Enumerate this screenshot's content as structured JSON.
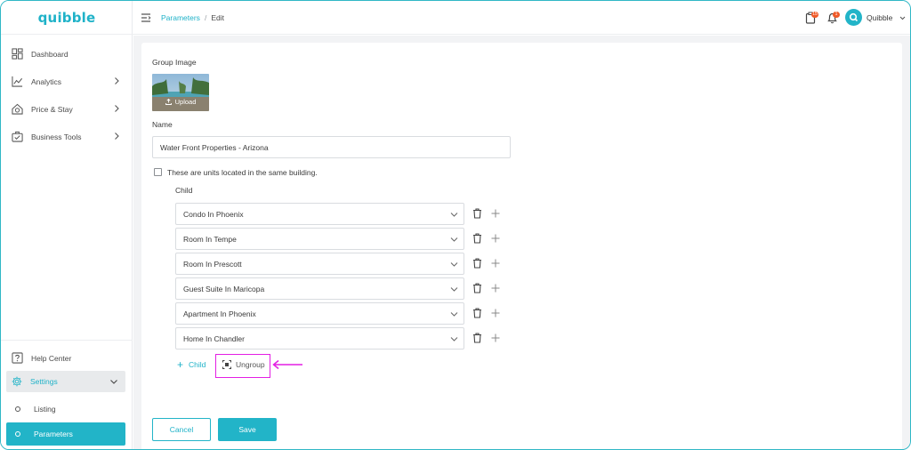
{
  "app": {
    "logo": "quibble",
    "brand_color": "#22b4c8",
    "highlight_color": "#e31fe3"
  },
  "sidebar": {
    "items": [
      {
        "label": "Dashboard",
        "icon": "dashboard-icon"
      },
      {
        "label": "Analytics",
        "icon": "analytics-icon"
      },
      {
        "label": "Price & Stay",
        "icon": "price-stay-icon"
      },
      {
        "label": "Business Tools",
        "icon": "business-tools-icon"
      }
    ],
    "help_label": "Help Center",
    "settings_label": "Settings",
    "sub_items": [
      {
        "label": "Listing",
        "active": false
      },
      {
        "label": "Parameters",
        "active": true
      }
    ]
  },
  "header": {
    "breadcrumb": {
      "parent": "Parameters",
      "separator": "/",
      "current": "Edit"
    },
    "notification_badges": [
      "15",
      "1"
    ],
    "user_name": "Quibble"
  },
  "form": {
    "group_image_label": "Group Image",
    "upload_label": "Upload",
    "name_label": "Name",
    "name_value": "Water Front Properties - Arizona",
    "same_building_label": "These are units located in the same building.",
    "same_building_checked": false,
    "child_label": "Child",
    "children": [
      "Condo In Phoenix",
      "Room In Tempe",
      "Room In Prescott",
      "Guest Suite In Maricopa",
      "Apartment In Phoenix",
      "Home In Chandler"
    ],
    "add_child_label": "Child",
    "ungroup_label": "Ungroup",
    "cancel_label": "Cancel",
    "save_label": "Save"
  }
}
